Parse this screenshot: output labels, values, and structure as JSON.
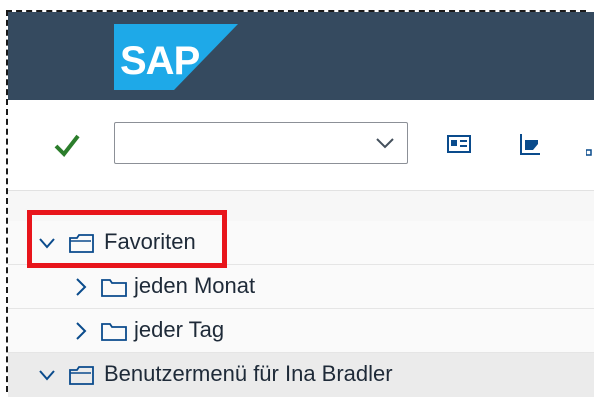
{
  "header": {
    "logo_text": "SAP",
    "brand_color": "#354a5f",
    "logo_color": "#1ea9e8"
  },
  "toolbar": {
    "enter_icon": "checkmark-icon",
    "command_field": {
      "value": "",
      "placeholder": ""
    },
    "icons": [
      "business-card-icon",
      "edit-document-icon",
      "more-icon"
    ]
  },
  "tree": {
    "items": [
      {
        "label": "Favoriten",
        "icon": "folder-open-icon",
        "expanded": true,
        "level": 0
      },
      {
        "label": "jeden Monat",
        "icon": "folder-icon",
        "expanded": false,
        "level": 1
      },
      {
        "label": "jeder Tag",
        "icon": "folder-icon",
        "expanded": false,
        "level": 1
      },
      {
        "label": "Benutzermenü für Ina Bradler",
        "icon": "folder-open-icon",
        "expanded": true,
        "level": 0
      }
    ]
  },
  "annotation": {
    "color": "#e8151b"
  }
}
